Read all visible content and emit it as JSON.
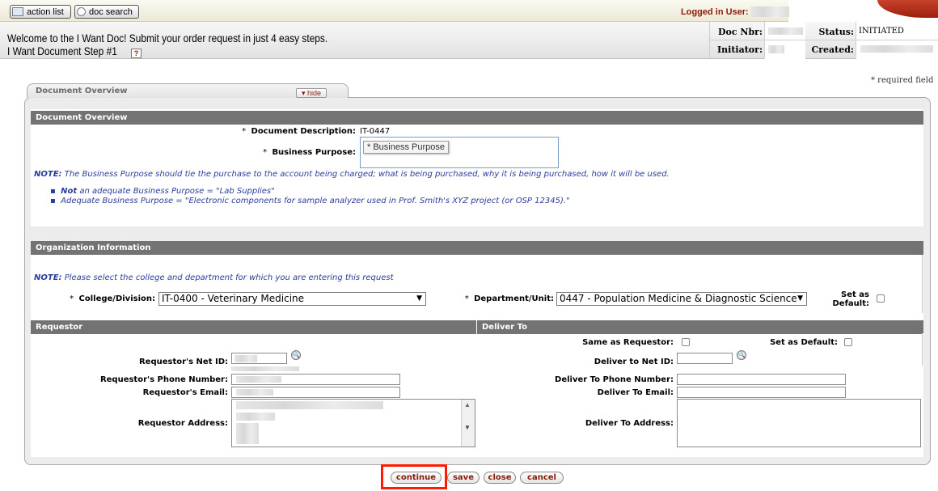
{
  "toolbar": {
    "action_list": "action list",
    "doc_search": "doc search",
    "logged_in_label": "Logged in User:"
  },
  "header": {
    "welcome": "Welcome to the I Want Doc! Submit your order request in just 4 easy steps.",
    "step": "I Want Document Step #1",
    "help": "?",
    "doc_nbr_label": "Doc Nbr:",
    "status_label": "Status:",
    "status_value": "INITIATED",
    "initiator_label": "Initiator:",
    "created_label": "Created:"
  },
  "required_note": "* required field",
  "tab": {
    "title": "Document Overview",
    "hide_label": "▾ hide"
  },
  "doc_overview": {
    "heading": "Document Overview",
    "description_label": "Document Description:",
    "description_value": "IT-0447",
    "purpose_label": "Business Purpose:",
    "purpose_tooltip": "* Business Purpose",
    "note_prefix": "NOTE:",
    "note_text": "The Business Purpose should tie the purchase to the account being charged; what is being purchased, why it is being purchased, how it will be used.",
    "bullet1_bold": "Not",
    "bullet1_text": "an adequate Business Purpose = \"Lab Supplies\"",
    "bullet2_text": "Adequate Business Purpose = \"Electronic components for sample analyzer used in Prof. Smith's XYZ project (or OSP 12345).\""
  },
  "org_info": {
    "heading": "Organization Information",
    "note_prefix": "NOTE:",
    "note_text": "Please select the college and department for which you are entering this request",
    "college_label": "College/Division:",
    "college_value": "IT-0400 - Veterinary Medicine",
    "dept_label": "Department/Unit:",
    "dept_value": "0447 - Population Medicine & Diagnostic Science",
    "set_default_label1": "Set as",
    "set_default_label2": "Default:"
  },
  "requestor": {
    "heading": "Requestor",
    "net_id_label": "Requestor's Net ID:",
    "phone_label": "Requestor's Phone Number:",
    "email_label": "Requestor's Email:",
    "address_label": "Requestor Address:"
  },
  "deliver": {
    "heading": "Deliver To",
    "same_label": "Same as Requestor:",
    "set_default_label": "Set as Default:",
    "net_id_label": "Deliver to Net ID:",
    "phone_label": "Deliver To Phone Number:",
    "email_label": "Deliver To Email:",
    "address_label": "Deliver To Address:"
  },
  "buttons": {
    "continue": "continue",
    "save": "save",
    "close": "close",
    "cancel": "cancel"
  },
  "colors": {
    "section_header": "#737373",
    "accent_red": "#8b1a0a",
    "highlight": "#ff1a00",
    "note_blue": "#2a3c9c"
  }
}
